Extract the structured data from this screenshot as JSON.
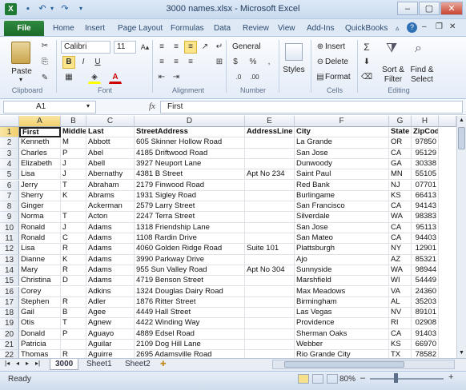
{
  "window": {
    "title": "3000 names.xlsx - Microsoft Excel",
    "min": "–",
    "max": "▢",
    "close": "✕"
  },
  "tabs": [
    "Home",
    "Insert",
    "Page Layout",
    "Formulas",
    "Data",
    "Review",
    "View",
    "Add-Ins",
    "QuickBooks"
  ],
  "file_tab": "File",
  "ribbon": {
    "paste": "Paste",
    "font_name": "Calibri",
    "font_size": "11",
    "bold": "B",
    "italic": "I",
    "underline": "U",
    "number_format": "General",
    "styles": "Styles",
    "insert": "Insert",
    "delete": "Delete",
    "format": "Format",
    "sort_filter": "Sort &",
    "sort_filter2": "Filter",
    "find_select": "Find &",
    "find_select2": "Select",
    "groups": [
      "Clipboard",
      "Font",
      "Alignment",
      "Number",
      "Cells",
      "Editing"
    ]
  },
  "formula": {
    "name_box": "A1",
    "fx": "fx",
    "value": "First"
  },
  "columns": [
    {
      "id": "A",
      "w": 52
    },
    {
      "id": "B",
      "w": 32
    },
    {
      "id": "C",
      "w": 60
    },
    {
      "id": "D",
      "w": 138
    },
    {
      "id": "E",
      "w": 62
    },
    {
      "id": "F",
      "w": 118
    },
    {
      "id": "G",
      "w": 28
    },
    {
      "id": "H",
      "w": 34
    }
  ],
  "rows": [
    {
      "n": "1",
      "c": [
        "First",
        "Middle",
        "Last",
        "StreetAddress",
        "AddressLine 2",
        "City",
        "State",
        "ZipCode"
      ]
    },
    {
      "n": "2",
      "c": [
        "Kenneth",
        "M",
        "Abbott",
        "605 Skinner Hollow Road",
        "",
        "La Grande",
        "OR",
        "97850"
      ]
    },
    {
      "n": "3",
      "c": [
        "Charles",
        "P",
        "Abel",
        "4185 Driftwood Road",
        "",
        "San Jose",
        "CA",
        "95129"
      ]
    },
    {
      "n": "4",
      "c": [
        "Elizabeth",
        "J",
        "Abell",
        "3927 Neuport Lane",
        "",
        "Dunwoody",
        "GA",
        "30338"
      ]
    },
    {
      "n": "5",
      "c": [
        "Lisa",
        "J",
        "Abernathy",
        "4381 B Street",
        "Apt No 234",
        "Saint Paul",
        "MN",
        "55105"
      ]
    },
    {
      "n": "6",
      "c": [
        "Jerry",
        "T",
        "Abraham",
        "2179 Finwood Road",
        "",
        "Red Bank",
        "NJ",
        "07701"
      ]
    },
    {
      "n": "7",
      "c": [
        "Sherry",
        "K",
        "Abrams",
        "1931 Sigley Road",
        "",
        "Burlingame",
        "KS",
        "66413"
      ]
    },
    {
      "n": "8",
      "c": [
        "Ginger",
        "",
        "Ackerman",
        "2579 Larry Street",
        "",
        "San Francisco",
        "CA",
        "94143"
      ]
    },
    {
      "n": "9",
      "c": [
        "Norma",
        "T",
        "Acton",
        "2247 Terra Street",
        "",
        "Silverdale",
        "WA",
        "98383"
      ]
    },
    {
      "n": "10",
      "c": [
        "Ronald",
        "J",
        "Adams",
        "1318 Friendship Lane",
        "",
        "San Jose",
        "CA",
        "95113"
      ]
    },
    {
      "n": "11",
      "c": [
        "Ronald",
        "C",
        "Adams",
        "1108 Rardin Drive",
        "",
        "San Mateo",
        "CA",
        "94403"
      ]
    },
    {
      "n": "12",
      "c": [
        "Lisa",
        "R",
        "Adams",
        "4060 Golden Ridge Road",
        "Suite 101",
        "Plattsburgh",
        "NY",
        "12901"
      ]
    },
    {
      "n": "13",
      "c": [
        "Dianne",
        "K",
        "Adams",
        "3990 Parkway Drive",
        "",
        "Ajo",
        "AZ",
        "85321"
      ]
    },
    {
      "n": "14",
      "c": [
        "Mary",
        "R",
        "Adams",
        "955 Sun Valley Road",
        "Apt No 304",
        "Sunnyside",
        "WA",
        "98944"
      ]
    },
    {
      "n": "15",
      "c": [
        "Christina",
        "D",
        "Adams",
        "4719 Benson Street",
        "",
        "Marshfield",
        "WI",
        "54449"
      ]
    },
    {
      "n": "16",
      "c": [
        "Corey",
        "",
        "Adkins",
        "1324 Douglas Dairy Road",
        "",
        "Max Meadows",
        "VA",
        "24360"
      ]
    },
    {
      "n": "17",
      "c": [
        "Stephen",
        "R",
        "Adler",
        "1876 Ritter Street",
        "",
        "Birmingham",
        "AL",
        "35203"
      ]
    },
    {
      "n": "18",
      "c": [
        "Gail",
        "B",
        "Agee",
        "4449 Hall Street",
        "",
        "Las Vegas",
        "NV",
        "89101"
      ]
    },
    {
      "n": "19",
      "c": [
        "Otis",
        "T",
        "Agnew",
        "4422 Winding Way",
        "",
        "Providence",
        "RI",
        "02908"
      ]
    },
    {
      "n": "20",
      "c": [
        "Donald",
        "P",
        "Aguayo",
        "4889 Edsel Road",
        "",
        "Sherman Oaks",
        "CA",
        "91403"
      ]
    },
    {
      "n": "21",
      "c": [
        "Patricia",
        "",
        "Aguilar",
        "2109 Dog Hill Lane",
        "",
        "Webber",
        "KS",
        "66970"
      ]
    },
    {
      "n": "22",
      "c": [
        "Thomas",
        "R",
        "Aguirre",
        "2695 Adamsville Road",
        "",
        "Rio Grande City",
        "TX",
        "78582"
      ]
    }
  ],
  "sheets": [
    "3000",
    "Sheet1",
    "Sheet2"
  ],
  "status": {
    "ready": "Ready",
    "zoom": "80%",
    "minus": "–",
    "plus": "+"
  }
}
